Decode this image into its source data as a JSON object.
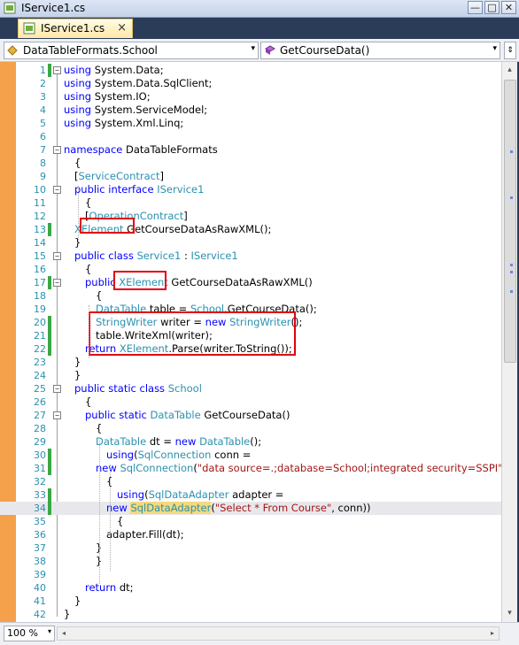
{
  "window": {
    "title": "IService1.cs",
    "minimize": "—",
    "maximize": "□",
    "close": "✕"
  },
  "tab": {
    "label": "IService1.cs",
    "close": "×"
  },
  "nav": {
    "type_combo": "DataTableFormats.School",
    "member_combo": "GetCourseData()",
    "arrow": "▾",
    "split": "⇕"
  },
  "editor": {
    "current_line": 34,
    "lines": [
      {
        "n": "1",
        "t": [
          [
            "kw",
            "using"
          ],
          [
            "",
            "System.Data;"
          ]
        ]
      },
      {
        "n": "2",
        "t": [
          [
            "kw",
            "using"
          ],
          [
            "",
            "System.Data.SqlClient;"
          ]
        ]
      },
      {
        "n": "3",
        "t": [
          [
            "kw",
            "using"
          ],
          [
            "",
            "System.IO;"
          ]
        ]
      },
      {
        "n": "4",
        "t": [
          [
            "kw",
            "using"
          ],
          [
            "",
            "System.ServiceModel;"
          ]
        ]
      },
      {
        "n": "5",
        "t": [
          [
            "kw",
            "using"
          ],
          [
            "",
            "System.Xml.Linq;"
          ]
        ]
      },
      {
        "n": "6",
        "t": []
      },
      {
        "n": "7",
        "t": [
          [
            "kw",
            "namespace"
          ],
          [
            "",
            "DataTableFormats"
          ]
        ]
      },
      {
        "n": "8",
        "t": [
          [
            "",
            "{"
          ]
        ]
      },
      {
        "n": "9",
        "t": [
          [
            "",
            "["
          ],
          [
            "ty",
            "ServiceContract"
          ],
          [
            "",
            "]"
          ]
        ]
      },
      {
        "n": "10",
        "t": [
          [
            "kw",
            "public"
          ],
          [
            "kw",
            "interface"
          ],
          [
            "ty",
            "IService1"
          ]
        ]
      },
      {
        "n": "11",
        "t": [
          [
            "",
            "{"
          ]
        ]
      },
      {
        "n": "12",
        "t": [
          [
            "",
            "["
          ],
          [
            "ty",
            "OperationContract"
          ],
          [
            "",
            "]"
          ]
        ]
      },
      {
        "n": "13",
        "t": [
          [
            "ty",
            "XElement"
          ],
          [
            "",
            "GetCourseDataAsRawXML();"
          ]
        ]
      },
      {
        "n": "14",
        "t": [
          [
            "",
            "}"
          ]
        ]
      },
      {
        "n": "15",
        "t": [
          [
            "kw",
            "public"
          ],
          [
            "kw",
            "class"
          ],
          [
            "ty",
            "Service1"
          ],
          [
            "",
            ":"
          ],
          [
            "ty",
            "IService1"
          ]
        ]
      },
      {
        "n": "16",
        "t": [
          [
            "",
            "{"
          ]
        ]
      },
      {
        "n": "17",
        "t": [
          [
            "kw",
            "public"
          ],
          [
            "ty",
            "XElement"
          ],
          [
            "",
            "GetCourseDataAsRawXML()"
          ]
        ]
      },
      {
        "n": "18",
        "t": [
          [
            "",
            "{"
          ]
        ]
      },
      {
        "n": "19",
        "t": [
          [
            "ty",
            "DataTable"
          ],
          [
            "",
            "table ="
          ],
          [
            "ty",
            "School"
          ],
          [
            "",
            ".GetCourseData();"
          ]
        ]
      },
      {
        "n": "20",
        "t": [
          [
            "ty",
            "StringWriter"
          ],
          [
            "",
            "writer ="
          ],
          [
            "kw",
            "new"
          ],
          [
            "ty",
            "StringWriter"
          ],
          [
            "",
            "();"
          ]
        ]
      },
      {
        "n": "21",
        "t": [
          [
            "",
            "table.WriteXml(writer);"
          ]
        ]
      },
      {
        "n": "22",
        "t": [
          [
            "kw",
            "return"
          ],
          [
            "ty",
            "XElement"
          ],
          [
            "",
            ".Parse(writer.ToString());"
          ]
        ]
      },
      {
        "n": "23",
        "t": [
          [
            "",
            "}"
          ]
        ]
      },
      {
        "n": "24",
        "t": [
          [
            "",
            "}"
          ]
        ]
      },
      {
        "n": "25",
        "t": [
          [
            "kw",
            "public"
          ],
          [
            "kw",
            "static"
          ],
          [
            "kw",
            "class"
          ],
          [
            "ty",
            "School"
          ]
        ]
      },
      {
        "n": "26",
        "t": [
          [
            "",
            "{"
          ]
        ]
      },
      {
        "n": "27",
        "t": [
          [
            "kw",
            "public"
          ],
          [
            "kw",
            "static"
          ],
          [
            "ty",
            "DataTable"
          ],
          [
            "",
            "GetCourseData()"
          ]
        ]
      },
      {
        "n": "28",
        "t": [
          [
            "",
            "{"
          ]
        ]
      },
      {
        "n": "29",
        "t": [
          [
            "ty",
            "DataTable"
          ],
          [
            "",
            "dt ="
          ],
          [
            "kw",
            "new"
          ],
          [
            "ty",
            "DataTable"
          ],
          [
            "",
            "();"
          ]
        ]
      },
      {
        "n": "30",
        "t": [
          [
            "kw",
            "using"
          ],
          [
            "",
            "("
          ],
          [
            "ty",
            "SqlConnection"
          ],
          [
            "",
            "conn ="
          ]
        ]
      },
      {
        "n": "31",
        "t": [
          [
            "kw",
            "new"
          ],
          [
            "ty",
            "SqlConnection"
          ],
          [
            "",
            "("
          ],
          [
            "st",
            "\"data source=.;database=School;integrated security=SSPI\""
          ],
          [
            "",
            "))"
          ]
        ]
      },
      {
        "n": "32",
        "t": [
          [
            "",
            "{"
          ]
        ]
      },
      {
        "n": "33",
        "t": [
          [
            "kw",
            "using"
          ],
          [
            "",
            "("
          ],
          [
            "ty",
            "SqlDataAdapter"
          ],
          [
            "",
            "adapter ="
          ]
        ]
      },
      {
        "n": "34",
        "t": [
          [
            "kw",
            "new"
          ],
          [
            "ty",
            "SqlDataAdapter"
          ],
          [
            "",
            "("
          ],
          [
            "st",
            "\"Select * From Course\""
          ],
          [
            "",
            ", conn))"
          ]
        ]
      },
      {
        "n": "35",
        "t": [
          [
            "",
            "{"
          ]
        ]
      },
      {
        "n": "36",
        "t": [
          [
            "",
            "adapter.Fill(dt);"
          ]
        ]
      },
      {
        "n": "37",
        "t": [
          [
            "",
            "}"
          ]
        ]
      },
      {
        "n": "38",
        "t": [
          [
            "",
            "}"
          ]
        ]
      },
      {
        "n": "39",
        "t": []
      },
      {
        "n": "40",
        "t": [
          [
            "kw",
            "return"
          ],
          [
            "",
            "dt;"
          ]
        ]
      },
      {
        "n": "41",
        "t": [
          [
            "",
            "}"
          ]
        ]
      },
      {
        "n": "42",
        "t": [
          [
            "",
            "}"
          ]
        ]
      }
    ]
  },
  "status": {
    "zoom": "100 %",
    "zoom_arrow": "▾",
    "left": "◂",
    "right": "▸"
  },
  "scroll": {
    "up": "▴",
    "down": "▾"
  }
}
